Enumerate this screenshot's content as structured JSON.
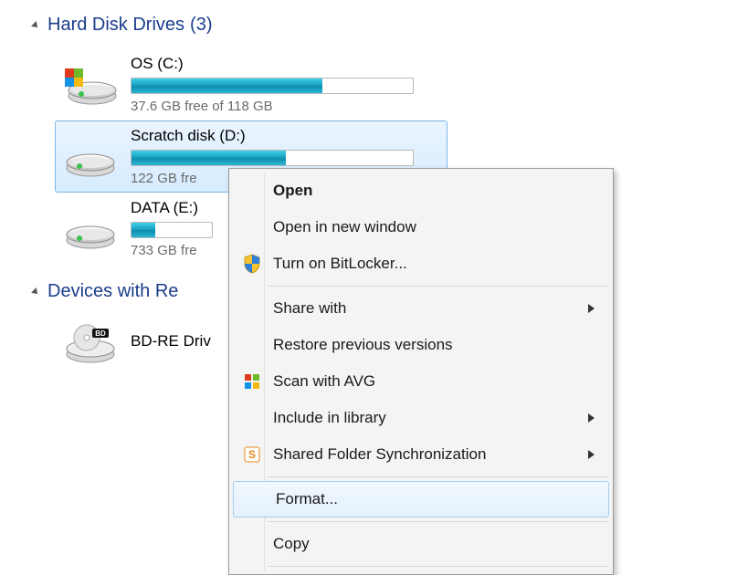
{
  "groups": [
    {
      "title": "Hard Disk Drives",
      "count": "(3)",
      "drives": [
        {
          "name": "OS (C:)",
          "free": "37.6 GB free of 118 GB",
          "pct": 68,
          "icon": "os",
          "selected": false
        },
        {
          "name": "Scratch disk (D:)",
          "free": "122 GB fre",
          "pct": 55,
          "icon": "hdd",
          "selected": true
        },
        {
          "name": "DATA (E:)",
          "free": "733 GB fre",
          "pct": 30,
          "icon": "hdd",
          "selected": false
        }
      ]
    },
    {
      "title": "Devices with Re",
      "count": "",
      "drives": [
        {
          "name": "BD-RE Driv",
          "free": "",
          "pct": null,
          "icon": "bd",
          "selected": false
        }
      ]
    }
  ],
  "menu": {
    "open": "Open",
    "open_new": "Open in new window",
    "bitlocker": "Turn on BitLocker...",
    "share": "Share with",
    "restore": "Restore previous versions",
    "scan_avg": "Scan with AVG",
    "include_lib": "Include in library",
    "shared_sync": "Shared Folder Synchronization",
    "format": "Format...",
    "copy": "Copy"
  }
}
